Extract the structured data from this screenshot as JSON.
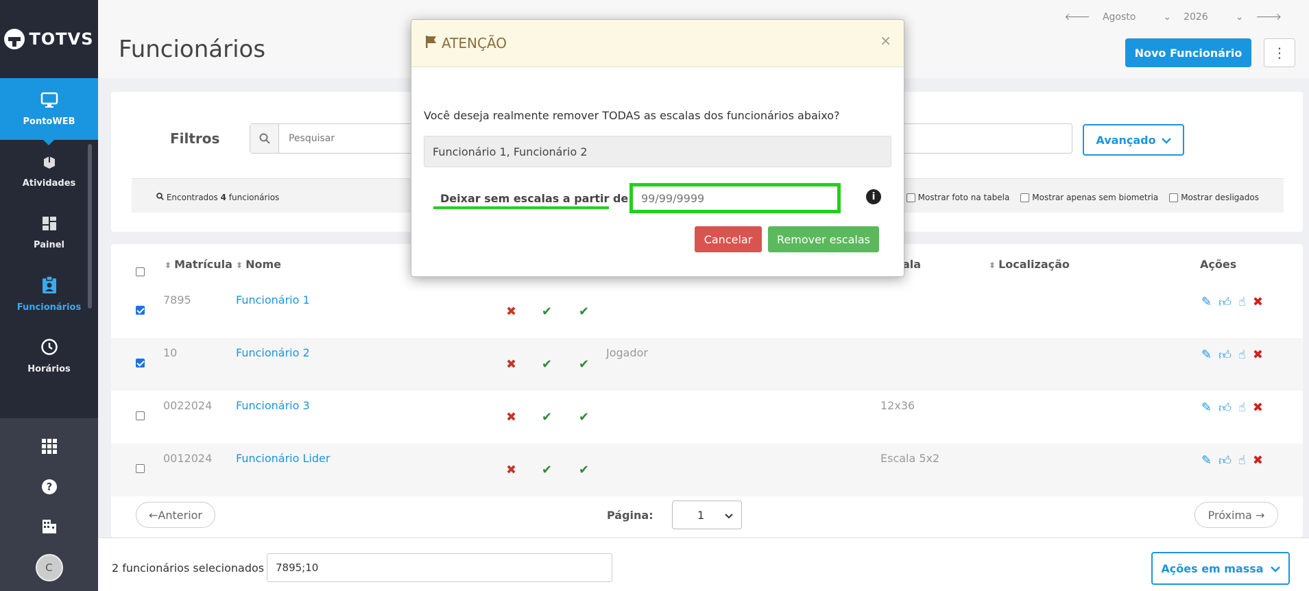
{
  "app": {
    "logo_text": "TOTVS"
  },
  "sidebar": {
    "items": [
      {
        "label": "PontoWEB",
        "icon": "monitor-icon"
      },
      {
        "label": "Atividades",
        "icon": "puzzle-icon"
      },
      {
        "label": "Painel",
        "icon": "dashboard-icon"
      },
      {
        "label": "Funcionários",
        "icon": "badge-icon"
      },
      {
        "label": "Horários",
        "icon": "clock-icon"
      }
    ],
    "avatar_initial": "C"
  },
  "header": {
    "title": "Funcionários",
    "month": "Agosto",
    "year": "2026",
    "new_button": "Novo Funcionário"
  },
  "filters": {
    "label": "Filtros",
    "search_placeholder": "Pesquisar",
    "advanced_button": "Avançado",
    "found_prefix": "Encontrados",
    "found_count": "4",
    "found_suffix": "funcionários",
    "options": [
      "Mostrar foto na tabela",
      "Mostrar apenas sem biometria",
      "Mostrar desligados"
    ]
  },
  "table": {
    "columns": {
      "matricula": "Matrícula",
      "nome": "Nome",
      "escala": "ala",
      "localizacao": "Localização",
      "acoes": "Ações"
    },
    "rows": [
      {
        "matricula": "7895",
        "nome": "Funcionário 1",
        "cargo": "",
        "escala": "",
        "checked": true
      },
      {
        "matricula": "10",
        "nome": "Funcionário 2",
        "cargo": "Jogador",
        "escala": "",
        "checked": true
      },
      {
        "matricula": "0022024",
        "nome": "Funcionário 3",
        "cargo": "",
        "escala": "12x36",
        "checked": false
      },
      {
        "matricula": "0012024",
        "nome": "Funcionário Lider",
        "cargo": "",
        "escala": "Escala 5x2",
        "checked": false
      }
    ],
    "pager": {
      "prev": "←Anterior",
      "label": "Página:",
      "page": "1",
      "next": "Próxima →"
    }
  },
  "footer": {
    "selected_text": "2 funcionários selecionados",
    "selected_ids": "7895;10",
    "mass_button": "Ações em massa"
  },
  "modal": {
    "title": "ATENÇÃO",
    "close": "×",
    "message": "Você deseja realmente remover TODAS as escalas dos funcionários abaixo?",
    "names": "Funcionário 1, Funcionário 2",
    "date_label": "Deixar sem escalas a partir de",
    "date_placeholder": "99/99/9999",
    "info": "i",
    "cancel": "Cancelar",
    "confirm": "Remover escalas"
  },
  "colors": {
    "accent": "#1a95df",
    "highlight": "#22d01b",
    "danger": "#d9534f",
    "success": "#5cb85c"
  }
}
